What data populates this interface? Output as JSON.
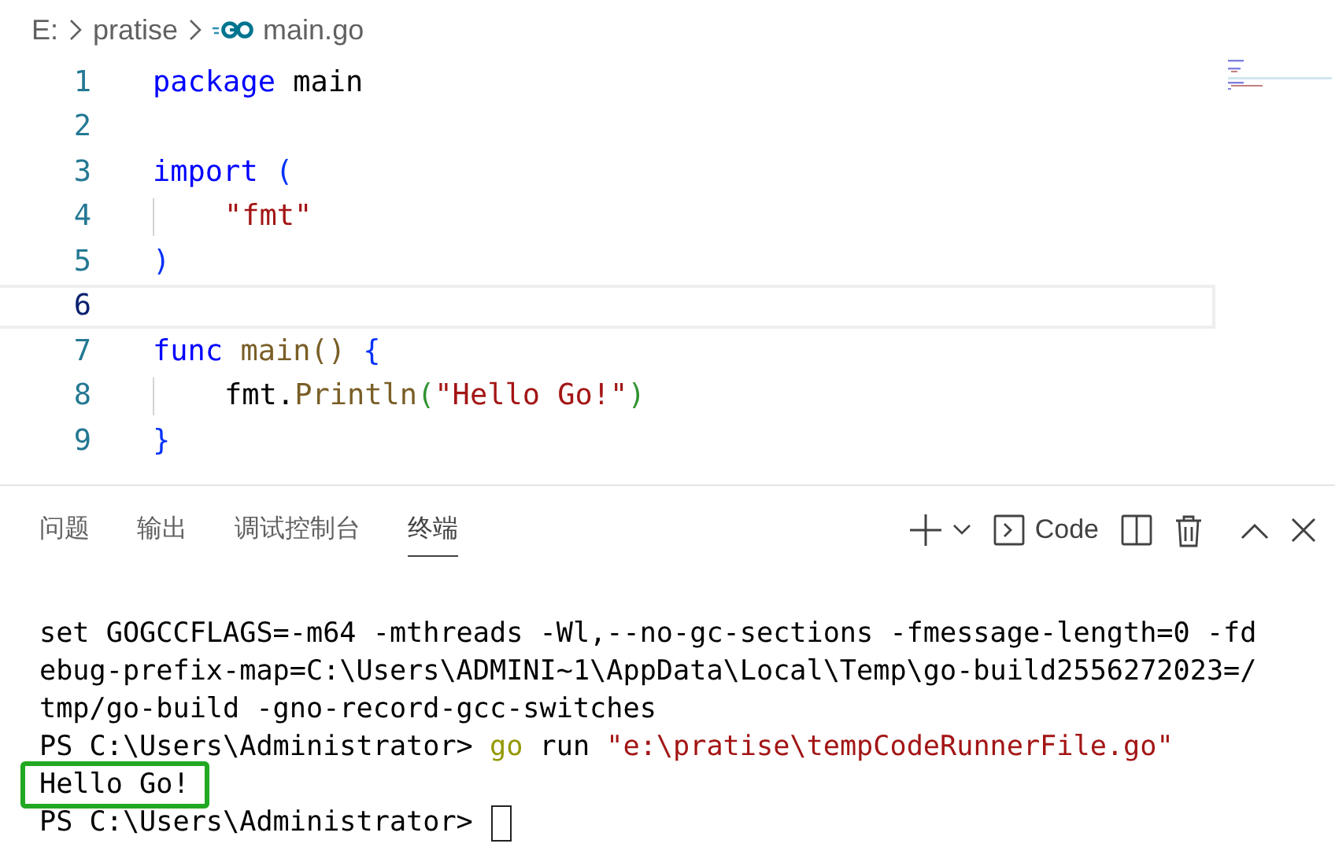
{
  "breadcrumb": [
    {
      "kind": "folder",
      "label": "E:"
    },
    {
      "kind": "folder",
      "label": "pratise"
    },
    {
      "kind": "go-file",
      "label": "main.go"
    }
  ],
  "editor": {
    "lines": [
      {
        "number": "1",
        "current": false,
        "tokens": [
          {
            "kind": "kw",
            "text": "package"
          },
          {
            "kind": "plain",
            "text": " main"
          }
        ]
      },
      {
        "number": "2",
        "current": false
      },
      {
        "number": "3",
        "current": false,
        "tokens": [
          {
            "kind": "kw",
            "text": "import"
          },
          {
            "kind": "b1",
            "text": " ("
          }
        ]
      },
      {
        "number": "4",
        "current": false,
        "indented": true,
        "tokens": [
          {
            "kind": "str",
            "text": "\"fmt\""
          }
        ]
      },
      {
        "number": "5",
        "current": false,
        "tokens": [
          {
            "kind": "b1",
            "text": ")"
          }
        ]
      },
      {
        "number": "6",
        "current": true
      },
      {
        "number": "7",
        "current": false,
        "tokens": [
          {
            "kind": "kw",
            "text": "func"
          },
          {
            "kind": "fn",
            "text": " main()"
          },
          {
            "kind": "b1",
            "text": " {"
          }
        ]
      },
      {
        "number": "8",
        "current": false,
        "indented": true,
        "tokens": [
          {
            "kind": "plain",
            "text": "fmt."
          },
          {
            "kind": "fn",
            "text": "Println"
          },
          {
            "kind": "b2",
            "text": "("
          },
          {
            "kind": "str",
            "text": "\"Hello Go!\""
          },
          {
            "kind": "b2",
            "text": ")"
          }
        ]
      },
      {
        "number": "9",
        "current": false,
        "tokens": [
          {
            "kind": "b1",
            "text": "}"
          }
        ]
      }
    ]
  },
  "panel": {
    "tabs": [
      {
        "label": "问题",
        "selected": false
      },
      {
        "label": "输出",
        "selected": false
      },
      {
        "label": "调试控制台",
        "selected": false
      },
      {
        "label": "终端",
        "selected": true
      }
    ],
    "terminal_label": "Code"
  },
  "terminal": {
    "lines": [
      {
        "boxed": false,
        "cursor": false,
        "tokens": [
          {
            "kind": "plain",
            "text": "set GOGCCFLAGS=-m64 -mthreads -Wl,--no-gc-sections -fmessage-length=0 -fd"
          }
        ]
      },
      {
        "boxed": false,
        "cursor": false,
        "tokens": [
          {
            "kind": "plain",
            "text": "ebug-prefix-map=C:\\Users\\ADMINI~1\\AppData\\Local\\Temp\\go-build2556272023=/"
          }
        ]
      },
      {
        "boxed": false,
        "cursor": false,
        "tokens": [
          {
            "kind": "plain",
            "text": "tmp/go-build -gno-record-gcc-switches"
          }
        ]
      },
      {
        "boxed": false,
        "cursor": false,
        "tokens": [
          {
            "kind": "plain",
            "text": "PS C:\\Users\\Administrator> "
          },
          {
            "kind": "cmd",
            "text": "go"
          },
          {
            "kind": "plain",
            "text": " run "
          },
          {
            "kind": "str",
            "text": "\"e:\\pratise\\tempCodeRunnerFile.go\""
          }
        ]
      },
      {
        "boxed": true,
        "cursor": false,
        "tokens": [
          {
            "kind": "plain",
            "text": "Hello Go!"
          }
        ]
      },
      {
        "boxed": false,
        "cursor": true,
        "tokens": [
          {
            "kind": "plain",
            "text": "PS C:\\Users\\Administrator> "
          }
        ]
      }
    ]
  }
}
